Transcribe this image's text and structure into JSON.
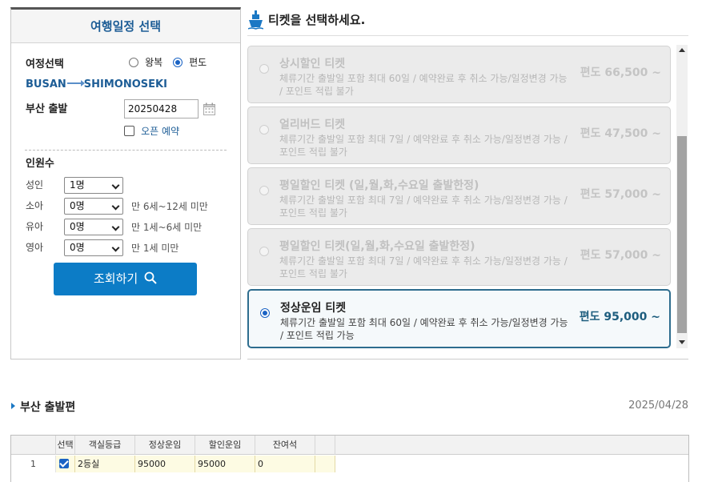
{
  "left_panel": {
    "title": "여행일정 선택",
    "trip_type_label": "여정선택",
    "trip_options": [
      "왕복",
      "편도"
    ],
    "trip_selected": "편도",
    "route_from": "BUSAN",
    "route_to": "SHIMONOSEKI",
    "departure_label": "부산 출발",
    "departure_date": "20250428",
    "open_booking_label": "오픈 예약",
    "pax_title": "인원수",
    "pax": [
      {
        "label": "성인",
        "value": "1명",
        "note": ""
      },
      {
        "label": "소아",
        "value": "0명",
        "note": "만 6세~12세 미만"
      },
      {
        "label": "유아",
        "value": "0명",
        "note": "만 1세~6세 미만"
      },
      {
        "label": "영아",
        "value": "0명",
        "note": "만 1세 미만"
      }
    ],
    "search_button": "조회하기"
  },
  "right_panel": {
    "title": "티켓을 선택하세요.",
    "tickets": [
      {
        "name": "상시할인 티켓",
        "desc": "체류기간 출발일 포함 최대 60일 / 예약완료 후 취소 가능/일정변경 가능 / 포인트 적립 불가",
        "price": "편도 66,500 ~",
        "selected": false
      },
      {
        "name": "얼리버드 티켓",
        "desc": "체류기간 출발일 포함 최대 7일 / 예약완료 후 취소 가능/일정변경 가능 / 포인트 적립 불가",
        "price": "편도 47,500 ~",
        "selected": false
      },
      {
        "name": "평일할인 티켓 (일,월,화,수요일 출발한정)",
        "desc": "체류기간 출발일 포함 최대 7일 / 예약완료 후 취소 가능/일정변경 가능 / 포인트 적립 불가",
        "price": "편도 57,000 ~",
        "selected": false
      },
      {
        "name": "평일할인 티켓(일,월,화,수요일 출발한정)",
        "desc": "체류기간 출발일 포함 최대 7일 / 예약완료 후 취소 가능/일정변경 가능 / 포인트 적립 불가",
        "price": "편도 57,000 ~",
        "selected": false
      },
      {
        "name": "정상운임 티켓",
        "desc": "체류기간 출발일 포함 최대 60일 / 예약완료 후 취소 가능/일정변경 가능 / 포인트 적립 가능",
        "price": "편도 95,000 ~",
        "selected": true
      }
    ]
  },
  "bottom": {
    "section_title": "부산 출발편",
    "section_date": "2025/04/28",
    "grid_headers": [
      "선택",
      "객실등급",
      "정상운임",
      "할인운임",
      "잔여석"
    ],
    "grid_rows": [
      {
        "row_num": "1",
        "checked": true,
        "room_class": "2등실",
        "normal_fare": "95000",
        "discount_fare": "95000",
        "seats_left": "0"
      }
    ]
  },
  "colors": {
    "accent_blue": "#0c7cc6",
    "title_blue": "#1d5d96",
    "selected_border": "#2e6d8e",
    "grid_highlight": "#fdfbe3"
  },
  "icons": {
    "calendar": "calendar-icon",
    "ship": "ship-icon",
    "search": "search-icon"
  }
}
